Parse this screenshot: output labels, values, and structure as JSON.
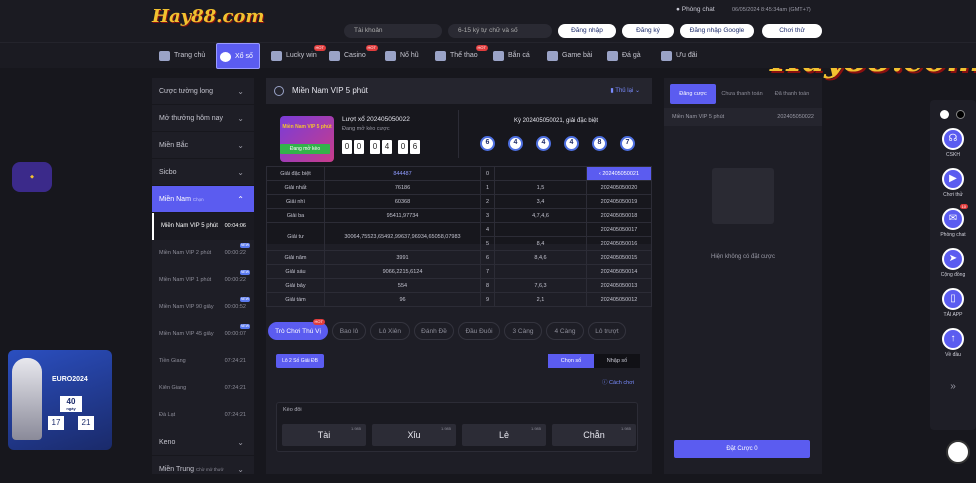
{
  "header": {
    "logo": "Hay88.com",
    "support": "Phòng chat",
    "time": "06/05/2024 8:45:34am",
    "tz": "(GMT+7)",
    "username_ph": "Tài khoản",
    "password_ph": "6-15 ký tự chữ và số",
    "login": "Đăng nhập",
    "register": "Đăng ký",
    "google": "Đăng nhập Google",
    "trial": "Chơi thử"
  },
  "nav": [
    {
      "label": "Trang chủ"
    },
    {
      "label": "Xổ số"
    },
    {
      "label": "Lucky win",
      "hot": "HOT"
    },
    {
      "label": "Casino",
      "hot": "HOT"
    },
    {
      "label": "Nổ hũ"
    },
    {
      "label": "Thể thao",
      "hot": "HOT"
    },
    {
      "label": "Bắn cá"
    },
    {
      "label": "Game bài"
    },
    {
      "label": "Đá gà"
    },
    {
      "label": "Ưu đãi"
    }
  ],
  "sidebar": {
    "items": [
      "Cược tường long",
      "Mở thưởng hôm nay",
      "Miền Bắc",
      "Sicbo",
      "Miền Nam",
      "Miền Trung",
      "Kieno"
    ],
    "mien_nam_note": "Chọn ",
    "subs": [
      {
        "label": "Miền Nam VIP 5 phút",
        "time": "00:04:06"
      },
      {
        "label": "Miền Nam VIP 2 phút",
        "time": "00:00:22",
        "tag": "NEW"
      },
      {
        "label": "Miền Nam VIP 1 phút",
        "time": "00:00:22",
        "tag": "NEW"
      },
      {
        "label": "Miền Nam VIP 90 giây",
        "time": "00:00:52",
        "tag": "NEW"
      },
      {
        "label": "Miền Nam VIP 45 giây",
        "time": "00:00:07",
        "tag": "NEW"
      },
      {
        "label": "Tiền Giang",
        "time": "07:24:21"
      },
      {
        "label": "Kiên Giang",
        "time": "07:24:21"
      },
      {
        "label": "Đà Lạt",
        "time": "07:24:21"
      }
    ],
    "kieno_label": "Keno",
    "mien_trung_note": "Chờ mở thưở"
  },
  "main": {
    "title": "Miền Nam VIP 5 phút",
    "rules": "Thủ lại",
    "round_label": "Lượt xổ 202405050022",
    "open_label": "Đang mở kèo cược",
    "badge_text": "Miền Nam VIP 5 phút",
    "status_btn": "Đang mở kèo",
    "countdown": [
      "0",
      "0",
      "0",
      "4",
      "0",
      "6"
    ],
    "last_label": "Kỳ 202405050021, giải đặc biệt",
    "balls": [
      "6",
      "4",
      "4",
      "4",
      "8",
      "7"
    ],
    "prizes": [
      [
        "Giải đặc biệt",
        "844487"
      ],
      [
        "Giải nhất",
        "76186"
      ],
      [
        "Giải nhì",
        "60368"
      ],
      [
        "Giải ba",
        "95411,97734"
      ],
      [
        "Giải tư",
        "30064,75523,65492,99637,96934,65058,07983"
      ],
      [
        "Giải năm",
        "3991"
      ],
      [
        "Giải sáu",
        "9066,2215,6124"
      ],
      [
        "Giải bảy",
        "554"
      ],
      [
        "Giải tám",
        "96"
      ]
    ],
    "heads": [
      [
        "0",
        ""
      ],
      [
        "1",
        "1,5"
      ],
      [
        "2",
        "3,4"
      ],
      [
        "3",
        "4,7,4,6"
      ],
      [
        "4",
        ""
      ],
      [
        "5",
        "8,4"
      ],
      [
        "6",
        "8,4,6"
      ],
      [
        "7",
        ""
      ],
      [
        "8",
        "7,6,3"
      ],
      [
        "9",
        "2,1"
      ]
    ],
    "periods": [
      "202405050021",
      "202405050020",
      "202405050019",
      "202405050018",
      "202405050017",
      "202405050016",
      "202405050015",
      "202405050014",
      "202405050013",
      "202405050012"
    ],
    "tabs": [
      "Trò Chơi Thú Vị",
      "Bao lô",
      "Lô Xiên",
      "Đánh Đề",
      "Đầu Đuôi",
      "3 Càng",
      "4 Càng",
      "Lô trượt"
    ],
    "tab_hot": "HOT",
    "subtag": "Lô 2 Số Giải ĐB",
    "select_num": "Chọn số",
    "input_num": "Nhập số",
    "how_to": "Cách chơi",
    "section": "Kèo đôi",
    "bets": [
      {
        "label": "Tài",
        "odds": "1.985"
      },
      {
        "label": "Xỉu",
        "odds": "1.985"
      },
      {
        "label": "Lẻ",
        "odds": "1.985"
      },
      {
        "label": "Chẵn",
        "odds": "1.985"
      }
    ]
  },
  "right": {
    "tabs": [
      "Đăng cược",
      "Chưa thanh toán",
      "Đã thanh toán"
    ],
    "game": "Miền Nam VIP 5 phút",
    "period": "202405050022",
    "empty": "Hiện không có đặt cược",
    "place": "Đặt Cược 0"
  },
  "dock": [
    {
      "label": "CSKH",
      "icon": "headset-icon"
    },
    {
      "label": "Chơi thử",
      "icon": "play-icon"
    },
    {
      "label": "Phòng chat",
      "icon": "chat-icon",
      "badge": "10"
    },
    {
      "label": "Cộng đồng",
      "icon": "telegram-icon"
    },
    {
      "label": "TẢI APP",
      "icon": "phone-icon"
    },
    {
      "label": "Về đầu",
      "icon": "arrow-up-icon"
    }
  ],
  "promo": {
    "euro": "EURO2024",
    "days": "40",
    "days_label": "ngày",
    "h": "17",
    "m": "21"
  }
}
